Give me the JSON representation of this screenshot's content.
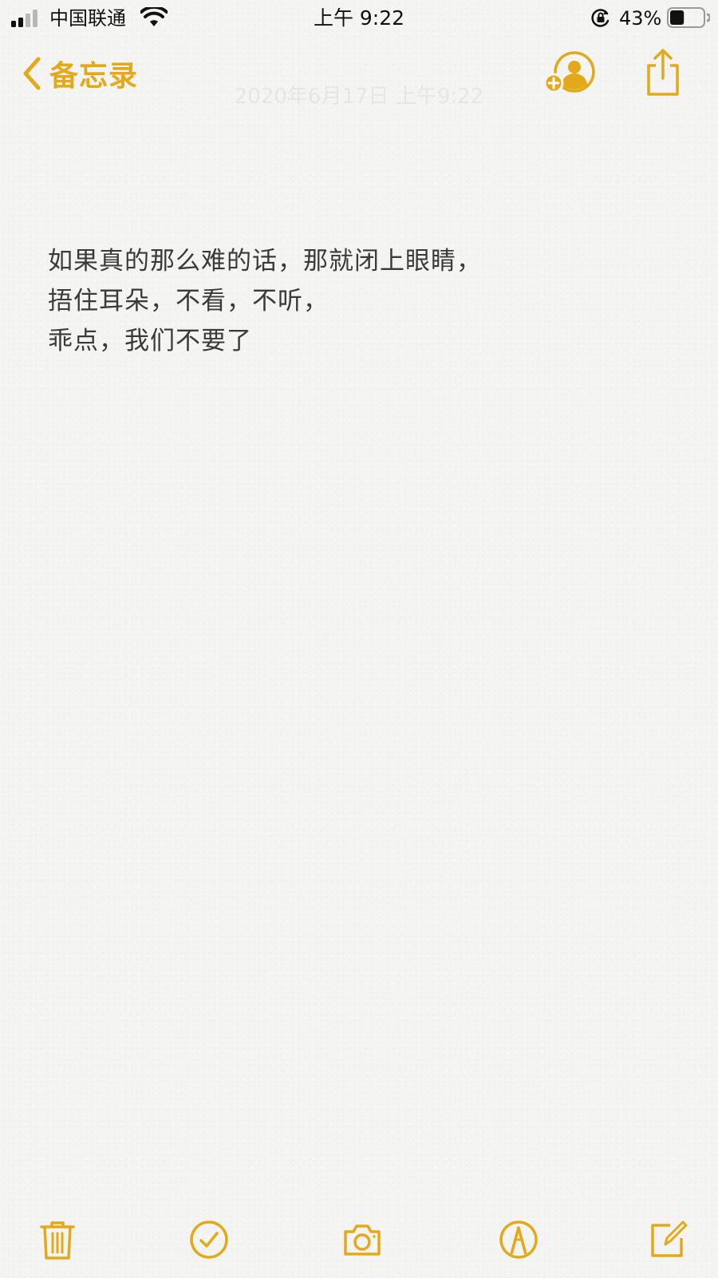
{
  "status_bar": {
    "carrier": "中国联通",
    "time": "上午 9:22",
    "battery_percent": "43%",
    "battery_level": 0.43,
    "icons": [
      "signal-icon",
      "wifi-icon",
      "rotation-lock-icon",
      "battery-icon"
    ]
  },
  "nav": {
    "back_label": "备忘录",
    "note_date": "2020年6月17日 上午9:22",
    "icons": [
      "chevron-left-icon",
      "add-person-icon",
      "share-icon"
    ]
  },
  "note": {
    "lines": [
      "如果真的那么难的话，那就闭上眼睛，",
      "捂住耳朵，不看，不听，",
      "乖点，我们不要了"
    ]
  },
  "toolbar": {
    "icons": [
      "trash-icon",
      "checklist-icon",
      "camera-icon",
      "markup-icon",
      "compose-icon"
    ]
  },
  "colors": {
    "accent": "#e3a91b",
    "text": "#3a3a3a",
    "background": "#f4f4f2"
  }
}
